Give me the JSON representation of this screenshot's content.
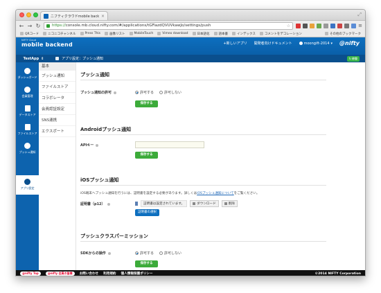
{
  "browser": {
    "tab_title": "ニフティクラウドmobile backend",
    "url_scheme": "https://",
    "url_rest": "console.mb.cloud.nifty.com/#/applications/tGFiazdQVUVkawJo/settings/push",
    "bookmarks": [
      "QRコード",
      "ニコニコチャンネル",
      "Press This",
      "画像リスト",
      "MobileTouch",
      "Vimeo download",
      "日本語化",
      "語本書",
      "インデックス",
      "コメントをデコレーション"
    ],
    "bookmarks_more": "その他のブックマーク"
  },
  "header": {
    "brand_small": "NIFTY Cloud",
    "brand_main": "mobile backend",
    "new_app": "+新しいアプリ",
    "docs": "開発者向けドキュメント",
    "user": "moongift-2014",
    "logo": "@nifty"
  },
  "subheader": {
    "app_name": "TestApp",
    "breadcrumb": "アプリ設定：プッシュ通知",
    "status": "稼働"
  },
  "sidebar": {
    "items": [
      {
        "label": "ダッシュボード"
      },
      {
        "label": "会員管理"
      },
      {
        "label": "データストア"
      },
      {
        "label": "ファイルストア"
      },
      {
        "label": "プッシュ通知"
      },
      {
        "label": "アプリ設定"
      }
    ]
  },
  "subnav": {
    "items": [
      "基本",
      "プッシュ通知",
      "ファイルストア",
      "コラボレータ",
      "会員認証設定",
      "SNS連携",
      "エクスポート"
    ]
  },
  "push": {
    "title": "プッシュ通知",
    "allow_label": "プッシュ通知の許可",
    "allow_on": "許可する",
    "allow_off": "許可しない",
    "save": "保存する"
  },
  "android": {
    "title": "Androidプッシュ通知",
    "api_label": "APIキー",
    "api_value": "",
    "save": "保存する"
  },
  "ios": {
    "title": "iOSプッシュ通知",
    "note_before": "iOS端末へプッシュ通知を行うには、証明書を設定する必要があります。詳しくは",
    "note_link": "iOSプッシュ通知について",
    "note_after": "をご覧ください。",
    "cert_label": "証明書（p12）",
    "cert_status": "証明書は設定されています。",
    "download": "ダウンロード",
    "delete": "削除",
    "select": "証明書の選択"
  },
  "class_permission": {
    "title": "プッシュクラスパーミッション",
    "sdk_label": "SDKからの操作",
    "allow_on": "許可する",
    "allow_off": "許可しない",
    "save": "保存する"
  },
  "footer": {
    "badge1": "@nifty Top",
    "badge2": "@nifty 会員の皆様",
    "contact": "お問い合わせ",
    "terms": "利用規約",
    "privacy": "個人情報保護ポリシー",
    "copyright": "©2014 NIFTY Corporation"
  }
}
